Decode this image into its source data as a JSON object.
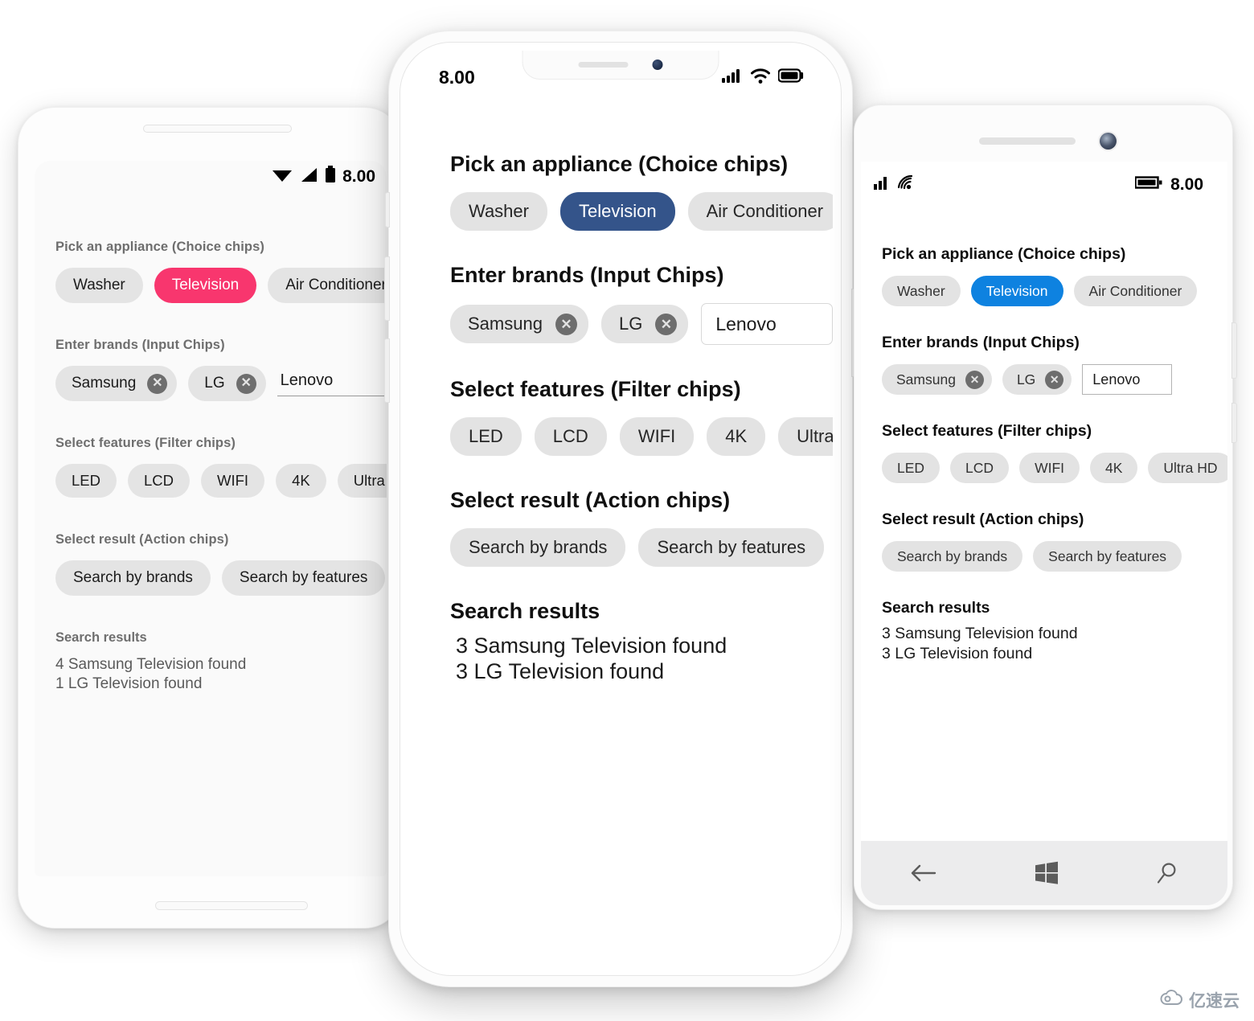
{
  "app": {
    "sections": {
      "choice_label": "Pick an appliance (Choice chips)",
      "input_label": "Enter brands (Input Chips)",
      "filter_label": "Select features (Filter chips)",
      "action_label": "Select result (Action chips)",
      "results_label": "Search results"
    },
    "choice_chips": [
      "Washer",
      "Television",
      "Air Conditioner"
    ],
    "selected_choice": "Television",
    "input_chips": [
      "Samsung",
      "LG"
    ],
    "input_field_value": "Lenovo",
    "filter_chips": [
      "LED",
      "LCD",
      "WIFI",
      "4K",
      "Ultra HD"
    ],
    "action_chips": [
      "Search by brands",
      "Search by features"
    ],
    "close_icon_glyph": "✕"
  },
  "android": {
    "platform": "android",
    "status": {
      "time": "8.00"
    },
    "results": [
      "4 Samsung Television found",
      "1 LG Television found"
    ],
    "accent": "#f8366e"
  },
  "ios": {
    "platform": "ios",
    "status": {
      "time": "8.00"
    },
    "results": [
      "3 Samsung Television found",
      "3 LG Television found"
    ],
    "accent": "#34548a"
  },
  "windows": {
    "platform": "windows",
    "status": {
      "time": "8.00"
    },
    "results": [
      "3 Samsung Television found",
      "3 LG Television found"
    ],
    "accent": "#0e82e0",
    "navbar": [
      "back",
      "windows-start",
      "search"
    ]
  },
  "watermark": {
    "text": "亿速云"
  }
}
